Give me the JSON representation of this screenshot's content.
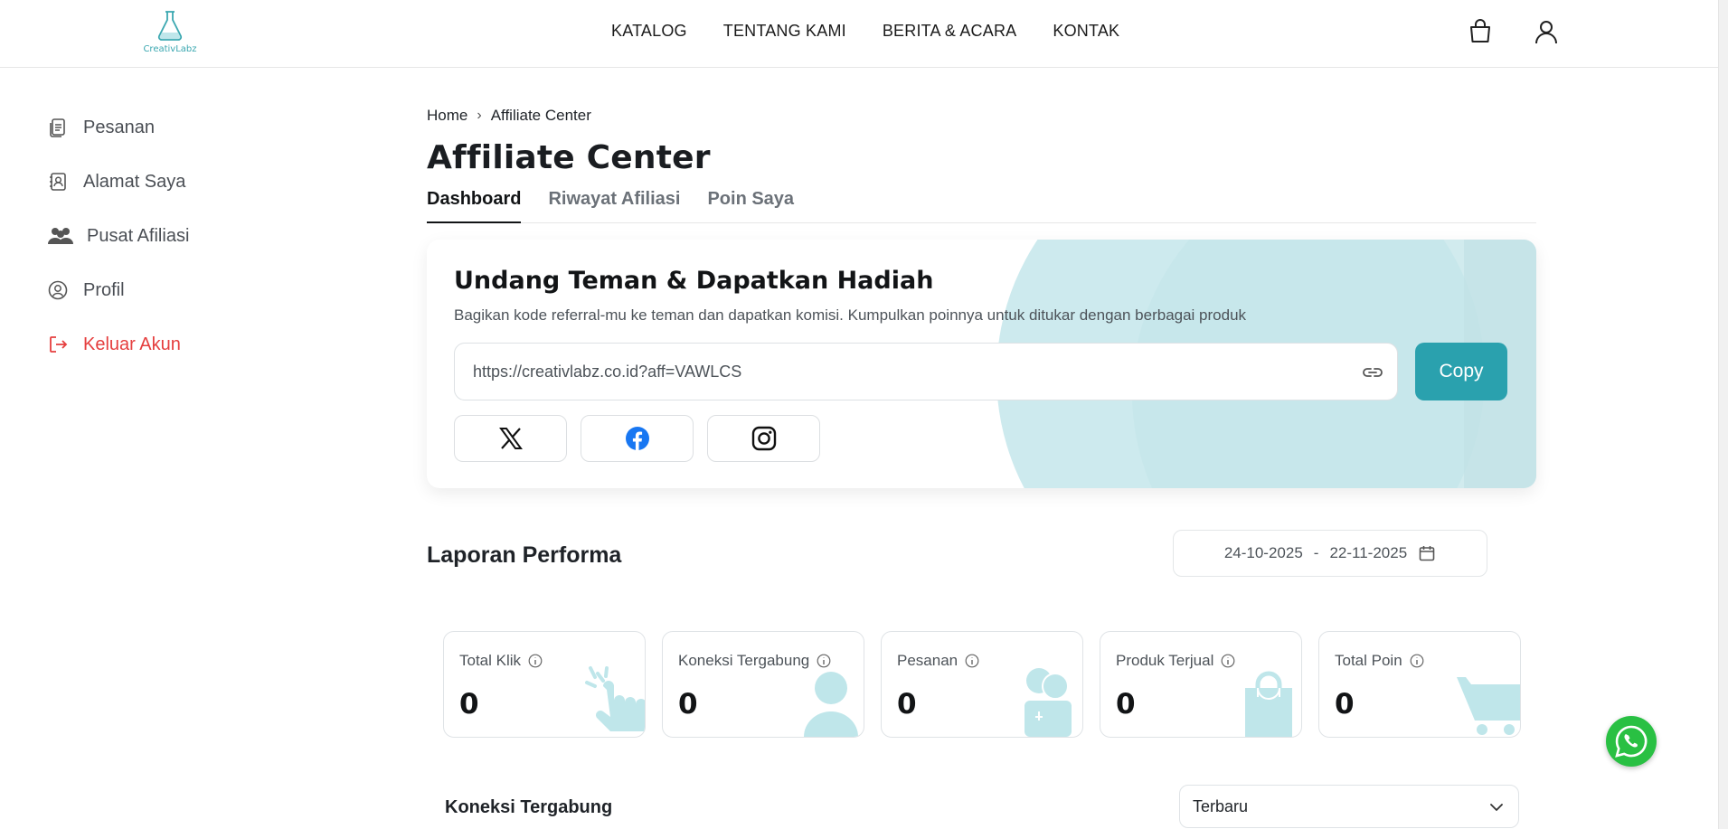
{
  "header": {
    "logo_text": "CreativLabz",
    "nav": [
      "KATALOG",
      "TENTANG KAMI",
      "BERITA & ACARA",
      "KONTAK"
    ],
    "icons": [
      "shopping-bag-icon",
      "user-icon"
    ]
  },
  "sidebar": {
    "items": [
      {
        "label": "Pesanan",
        "icon": "document-icon"
      },
      {
        "label": "Alamat Saya",
        "icon": "address-book-icon"
      },
      {
        "label": "Pusat Afiliasi",
        "icon": "users-icon"
      },
      {
        "label": "Profil",
        "icon": "profile-circle-icon"
      },
      {
        "label": "Keluar Akun",
        "icon": "logout-icon"
      }
    ]
  },
  "main": {
    "breadcrumb": [
      "Home",
      "›",
      "Affiliate Center"
    ],
    "title": "Affiliate Center",
    "tabs": [
      "Dashboard",
      "Riwayat Afiliasi",
      "Poin Saya"
    ],
    "active_tab": "Dashboard",
    "invite": {
      "title": "Undang Teman & Dapatkan Hadiah",
      "subtitle": "Bagikan kode referral-mu ke teman dan dapatkan komisi. Kumpulkan poinnya untuk ditukar dengan berbagai produk",
      "referral_link": "https://creativlabz.co.id?aff=VAWLCS",
      "copy_label": "Copy",
      "share_icons": [
        "x-icon",
        "facebook-icon",
        "instagram-icon"
      ]
    },
    "performance": {
      "title": "Laporan Performa",
      "date_start": "24-10-2025",
      "date_sep": "-",
      "date_end": "22-11-2025",
      "stats": [
        {
          "label": "Total Klik",
          "value": "0",
          "art": "tap-hand-icon"
        },
        {
          "label": "Koneksi Tergabung",
          "value": "0",
          "art": "person-icon"
        },
        {
          "label": "Pesanan",
          "value": "0",
          "art": "money-jar-icon"
        },
        {
          "label": "Produk Terjual",
          "value": "0",
          "art": "shopping-bag-icon"
        },
        {
          "label": "Total Poin",
          "value": "0",
          "art": "cart-icon"
        }
      ]
    },
    "connections": {
      "title": "Koneksi Tergabung",
      "sort_value": "Terbaru"
    }
  },
  "colors": {
    "accent": "#2aa1ae",
    "accent_light": "#cdeaee",
    "danger": "#e53e3e",
    "whatsapp": "#29c043"
  }
}
